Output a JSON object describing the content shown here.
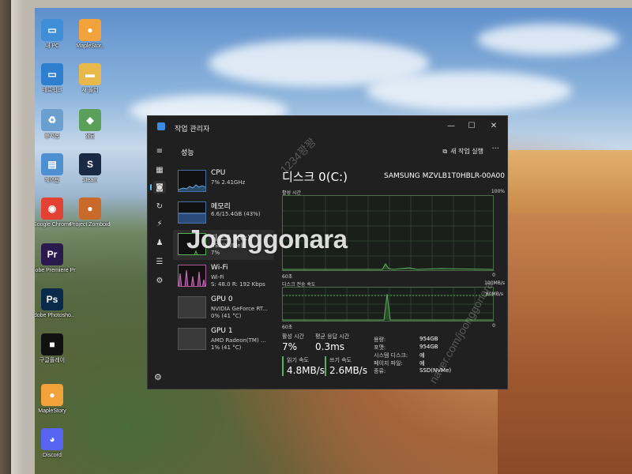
{
  "desktop": {
    "icons": [
      {
        "label": "내 PC",
        "color": "#3f8fd8",
        "glyph": "▭"
      },
      {
        "label": "MapleStor..",
        "color": "#f2a23a",
        "glyph": "●"
      },
      {
        "label": "네트워크",
        "color": "#2f7fd0",
        "glyph": "▭"
      },
      {
        "label": "새 폴더",
        "color": "#e8b84a",
        "glyph": "▬"
      },
      {
        "label": "휴지통",
        "color": "#6a9fd0",
        "glyph": "♻"
      },
      {
        "label": "잠금",
        "color": "#5aa05a",
        "glyph": "◆"
      },
      {
        "label": "제어판",
        "color": "#4d8fd0",
        "glyph": "▤"
      },
      {
        "label": "Steam",
        "color": "#1b2a44",
        "glyph": "S"
      },
      {
        "label": "Google Chrome",
        "color": "#e34133",
        "glyph": "◉"
      },
      {
        "label": "Project Zomboid",
        "color": "#c96a2a",
        "glyph": "●"
      },
      {
        "label": "Adobe Premiere Pr..",
        "color": "#2a1a4e",
        "glyph": "Pr"
      },
      {
        "label": "Adobe Photosho..",
        "color": "#0a2a4a",
        "glyph": "Ps"
      },
      {
        "label": "구글플레이",
        "color": "#111111",
        "glyph": "■"
      },
      {
        "label": "MapleStory",
        "color": "#f2a23a",
        "glyph": "●"
      },
      {
        "label": "Discord",
        "color": "#5865f2",
        "glyph": "◕"
      }
    ]
  },
  "window": {
    "title": "작업 관리자",
    "minimize": "—",
    "maximize": "☐",
    "close": "✕"
  },
  "header": {
    "section": "성능",
    "new_task": "새 작업 실행",
    "more": "···"
  },
  "sidebar_icons": [
    "≡",
    "▦",
    "◙",
    "↻",
    "⚡",
    "♟",
    "☰",
    "⚙"
  ],
  "perf_items": [
    {
      "name": "CPU",
      "sub1": "7% 2.41GHz",
      "sub2": ""
    },
    {
      "name": "메모리",
      "sub1": "6.6/15.4GB (43%)",
      "sub2": ""
    },
    {
      "name": "디스크 0(C:)",
      "sub1": "SSD(NVMe)",
      "sub2": "7%"
    },
    {
      "name": "Wi-Fi",
      "sub1": "Wi-Fi",
      "sub2": "S: 48.0 R: 192 Kbps"
    },
    {
      "name": "GPU 0",
      "sub1": "NVIDIA GeForce RT...",
      "sub2": "0% (41 °C)"
    },
    {
      "name": "GPU 1",
      "sub1": "AMD Radeon(TM) ...",
      "sub2": "1% (41 °C)"
    }
  ],
  "detail": {
    "title": "디스크 0(C:)",
    "model": "SAMSUNG MZVLB1T0HBLR-00A00",
    "graph1": {
      "label": "활성 시간",
      "max": "100%",
      "time": "60초",
      "min": "0"
    },
    "graph2": {
      "label": "디스크 전송 속도",
      "max": "100MB/s",
      "mark": "80MB/s",
      "time": "60초",
      "min": "0"
    },
    "active_time": {
      "label": "활성 시간",
      "value": "7%"
    },
    "avg_response": {
      "label": "평균 응답 시간",
      "value": "0.3ms"
    },
    "read_speed": {
      "label": "읽기 속도",
      "value": "4.8MB/s"
    },
    "write_speed": {
      "label": "쓰기 속도",
      "value": "2.6MB/s"
    },
    "props": [
      {
        "k": "용량:",
        "v": "954GB"
      },
      {
        "k": "포맷:",
        "v": "954GB"
      },
      {
        "k": "시스템 디스크:",
        "v": "예"
      },
      {
        "k": "페이지 파일:",
        "v": "예"
      },
      {
        "k": "종류:",
        "v": "SSD(NVMe)"
      }
    ]
  },
  "watermark": {
    "main": "Joonggonara",
    "secondary": "naver.com/joonggonara",
    "tag": "1234꽝꽝"
  },
  "colors": {
    "accent": "#4cc2ff",
    "graph_line": "#5ab25a",
    "window_bg": "#202020"
  }
}
